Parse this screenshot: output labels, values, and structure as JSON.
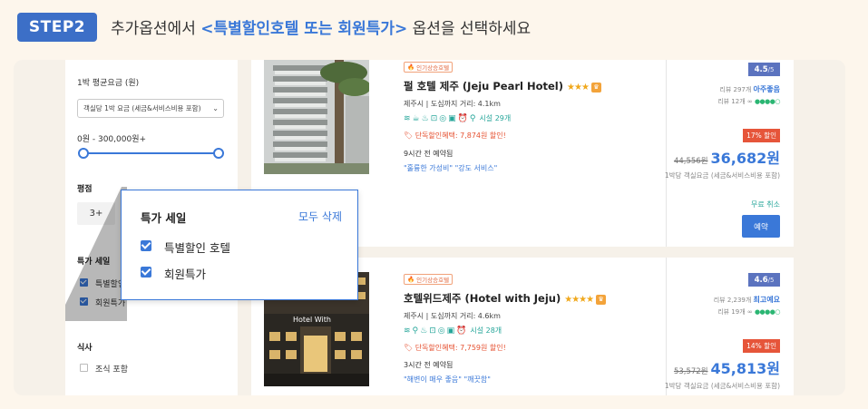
{
  "header": {
    "step_label": "STEP2",
    "instruction_prefix": "추가옵션에서 ",
    "instruction_highlight": "<특별할인호텔 또는 회원특가>",
    "instruction_suffix": " 옵션을 선택하세요"
  },
  "sidebar": {
    "price_title": "1박 평균요금 (원)",
    "price_select": "객실당 1박 요금 (세금&서비스비용 포함)",
    "price_range": "0원 - 300,000원+",
    "rating_title": "평점",
    "rating_option": "3+",
    "special_title": "특가 세일",
    "special_items": [
      {
        "label": "특별할인호텔",
        "checked": true
      },
      {
        "label": "회원특가",
        "checked": true
      }
    ],
    "meal_title": "식사",
    "meal_items": [
      {
        "label": "조식 포함",
        "checked": false
      }
    ]
  },
  "popup": {
    "title": "특가 세일",
    "clear_label": "모두 삭제",
    "options": [
      {
        "label": "특별할인 호텔",
        "checked": true
      },
      {
        "label": "회원특가",
        "checked": true
      }
    ]
  },
  "hotels": [
    {
      "tag": "인기상승호텔",
      "name": "펄 호텔 제주 (Jeju Pearl Hotel)",
      "stars": "★★★",
      "location": "제주시 | 도심까지 거리: 4.1km",
      "amenity_count": "시설 29개",
      "discount": "단독할인혜택: 7,874원 할인!",
      "recent_booking": "9시간 전 예약됨",
      "review_quotes": "\"훌륭한 가성비\" \"강도 서비스\"",
      "score": "4.5",
      "score_max": "/5",
      "review_count": "리뷰 297개",
      "review_grade": "아주좋음",
      "ta_count": "리뷰 12개",
      "ta_bubbles": "●●●●○",
      "discount_badge": "17% 할인",
      "original_price": "44,556원",
      "price": "36,682원",
      "price_note": "1박당 객실요금 (세금&서비스비용 포함)",
      "free_cancel": "무료 취소",
      "book_label": "예약"
    },
    {
      "tag": "인기상승호텔",
      "name": "호텔위드제주 (Hotel with Jeju)",
      "stars": "★★★★",
      "location": "제주시 | 도심까지 거리: 4.6km",
      "amenity_count": "시설 28개",
      "discount": "단독할인혜택: 7,759원 할인!",
      "recent_booking": "3시간 전 예약됨",
      "review_quotes": "\"해변이 매우 좋음\" \"깨끗함\"",
      "score": "4.6",
      "score_max": "/5",
      "review_count": "리뷰 2,239개",
      "review_grade": "최고예요",
      "ta_count": "리뷰 19개",
      "ta_bubbles": "●●●●○",
      "discount_badge": "14% 할인",
      "original_price": "53,572원",
      "price": "45,813원",
      "price_note": "1박당 객실요금 (세금&서비스비용 포함)",
      "image_sign": "Hotel With"
    }
  ],
  "colors": {
    "accent": "#3a78d8",
    "step_badge": "#3c6fc7",
    "page_bg": "#fdf6ec",
    "discount_red": "#e6553a",
    "amenity_teal": "#26a69a"
  }
}
